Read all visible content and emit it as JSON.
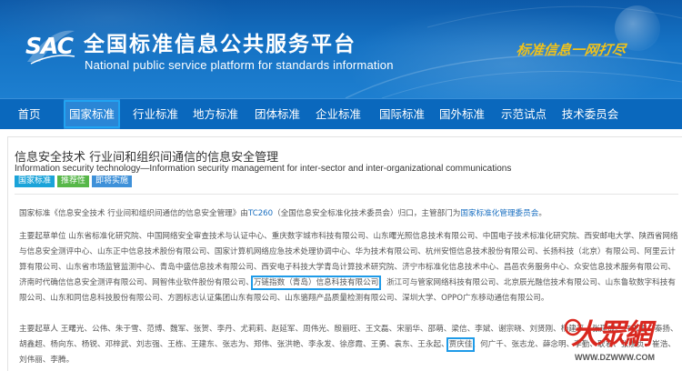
{
  "header": {
    "logo_text": "SAC",
    "title": "全国标准信息公共服务平台",
    "subtitle": "National public service platform  for standards information",
    "slogan": "标准信息一网打尽"
  },
  "nav": {
    "items": [
      {
        "label": "首页"
      },
      {
        "label": "国家标准"
      },
      {
        "label": "行业标准"
      },
      {
        "label": "地方标准"
      },
      {
        "label": "团体标准"
      },
      {
        "label": "企业标准"
      },
      {
        "label": "国际标准"
      },
      {
        "label": "国外标准"
      },
      {
        "label": "示范试点"
      },
      {
        "label": "技术委员会"
      }
    ],
    "active_index": 1
  },
  "standard": {
    "title_cn": "信息安全技术 行业间和组织间通信的信息安全管理",
    "title_en": "Information security technology—Information security management for inter-sector and inter-organizational communications",
    "tags": [
      {
        "label": "国家标准",
        "color": "#1aa3d9"
      },
      {
        "label": "推荐性",
        "color": "#57b749"
      },
      {
        "label": "即将实施",
        "color": "#3f91d9"
      }
    ],
    "p1": {
      "a": "国家标准《信息安全技术 行业间和组织间通信的信息安全管理》由",
      "b": "TC260",
      "c": "（全国信息安全标准化技术委员会）归口，主管部门为",
      "d": "国家标准化管理委员会",
      "e": "。"
    },
    "p2": {
      "a": "主要起草单位 山东省标准化研究院、中国网络安全审查技术与认证中心、重庆数字城市科技有限公司、山东曙光照信息技术有限公司、中国电子技术标准化研究院、西安邮电大学、陕西省网络与信息安全测评中心、山东正中信息技术股份有限公司、国家计算机网络应急技术处理协调中心、华为技术有限公司、杭州安恒信息技术股份有限公司、长扬科技（北京）有限公司、阿里云计算有限公司、山东省市场监管监测中心、青岛中盛信息技术有限公司、西安电子科技大学青岛计算技术研究院、济宁市标准化信息技术中心、昌邑农务服务中心、众安信息技术服务有限公司、济南时代确信信息安全测评有限公司、网智伟业软件股份有限公司、",
      "highlight": "万链指数（青岛）信息科技有限公司",
      "b": "、浙江可与管家网络科技有限公司、北京辰光融信技术有限公司、山东鲁软数字科技有限公司、山东和同信息科技股份有限公司、方圆标志认证集团山东有限公司、山东骆翔产品质量检测有限公司、深圳大学、OPPO广东移动通信有限公司。"
    },
    "p3": {
      "a": "主要起草人 王曙光、公伟、朱于雪、范博、魏军、张贺、李丹、尤莉莉、赵延军、周伟光、殷丽旺、王文磊、宋丽华、邵萌、梁信、李斌、谢宗晓、刘贤刚、杨建平、张建成、许志国、秦扬、胡鑫超、杨向东、杨锐、邓梓武、刘志强、王栋、王建东、张志为、郑伟、张洪艳、李永发、徐彦霞、王勇、袁东、王永起、",
      "highlight": "贾庆佳",
      "b": "、何广千、张志龙、薛念明、李勤、耿君、张淑贞、崔浩、刘伟丽、李腾。"
    }
  },
  "watermark": {
    "cn": "大眾網",
    "url": "WWW.DZWWW.COM"
  },
  "colors": {
    "header_blue": "#1572c4",
    "nav_blue": "#0a68bd",
    "link": "#1a6fc0",
    "highlight_box": "#1e9be8",
    "slogan": "#f0c21b",
    "watermark": "#d9281f"
  }
}
